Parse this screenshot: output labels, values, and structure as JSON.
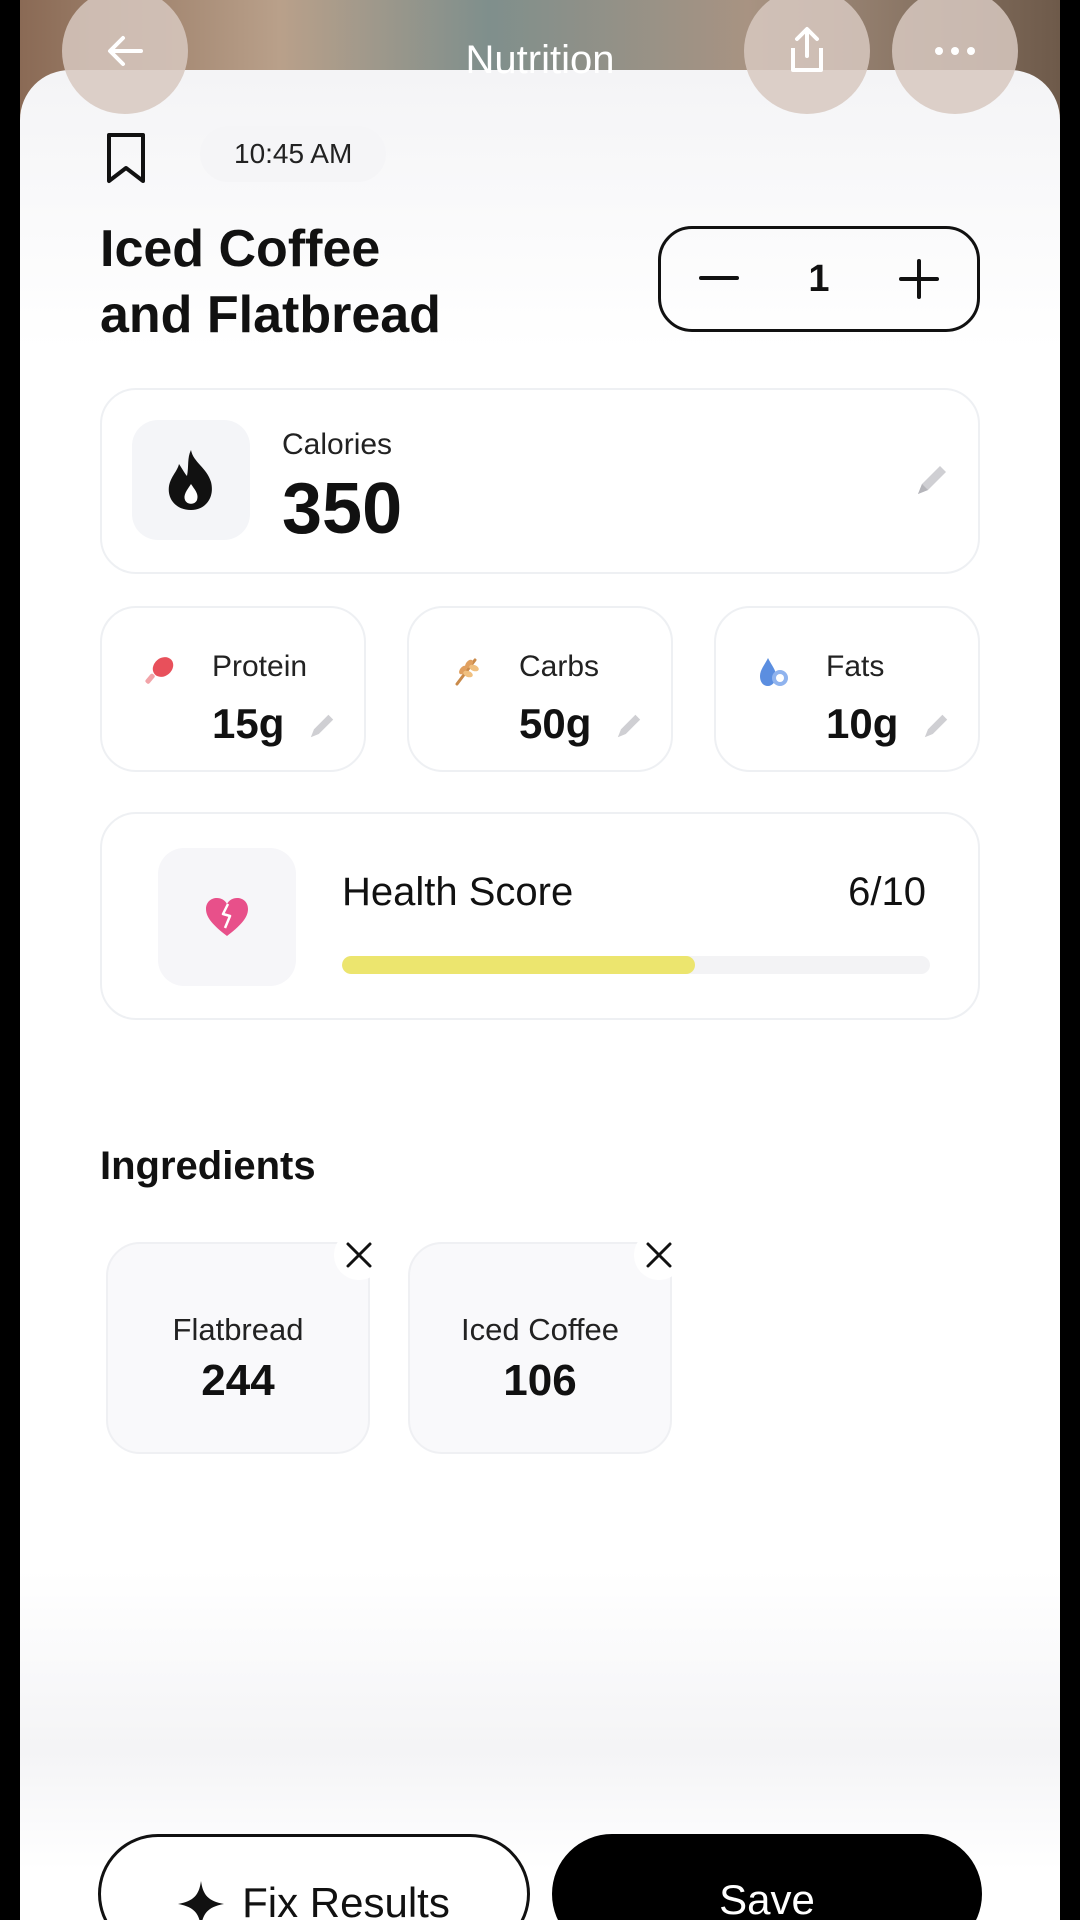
{
  "header": {
    "title": "Nutrition",
    "back_icon": "arrow-left-icon",
    "share_icon": "share-icon",
    "more_icon": "more-horizontal-icon"
  },
  "meal": {
    "time": "10:45 AM",
    "title_line1": "Iced Coffee",
    "title_line2": "and Flatbread",
    "quantity": "1",
    "decrement_symbol": "−",
    "increment_symbol": "+"
  },
  "calories": {
    "label": "Calories",
    "value": "350",
    "icon": "flame-icon"
  },
  "macros": [
    {
      "label": "Protein",
      "value": "15g",
      "icon": "drumstick-icon",
      "color": "#e8505b"
    },
    {
      "label": "Carbs",
      "value": "50g",
      "icon": "wheat-icon",
      "color": "#e0a060"
    },
    {
      "label": "Fats",
      "value": "10g",
      "icon": "oil-drop-icon",
      "color": "#5b8ee0"
    }
  ],
  "health_score": {
    "label": "Health Score",
    "value": "6/10",
    "fraction": 0.6,
    "bar_color": "#ece56e",
    "icon_color": "#e8508a"
  },
  "ingredients": {
    "title": "Ingredients",
    "items": [
      {
        "name": "Flatbread",
        "calories": "244"
      },
      {
        "name": "Iced Coffee",
        "calories": "106"
      }
    ]
  },
  "actions": {
    "fix_label": "Fix Results",
    "save_label": "Save"
  }
}
